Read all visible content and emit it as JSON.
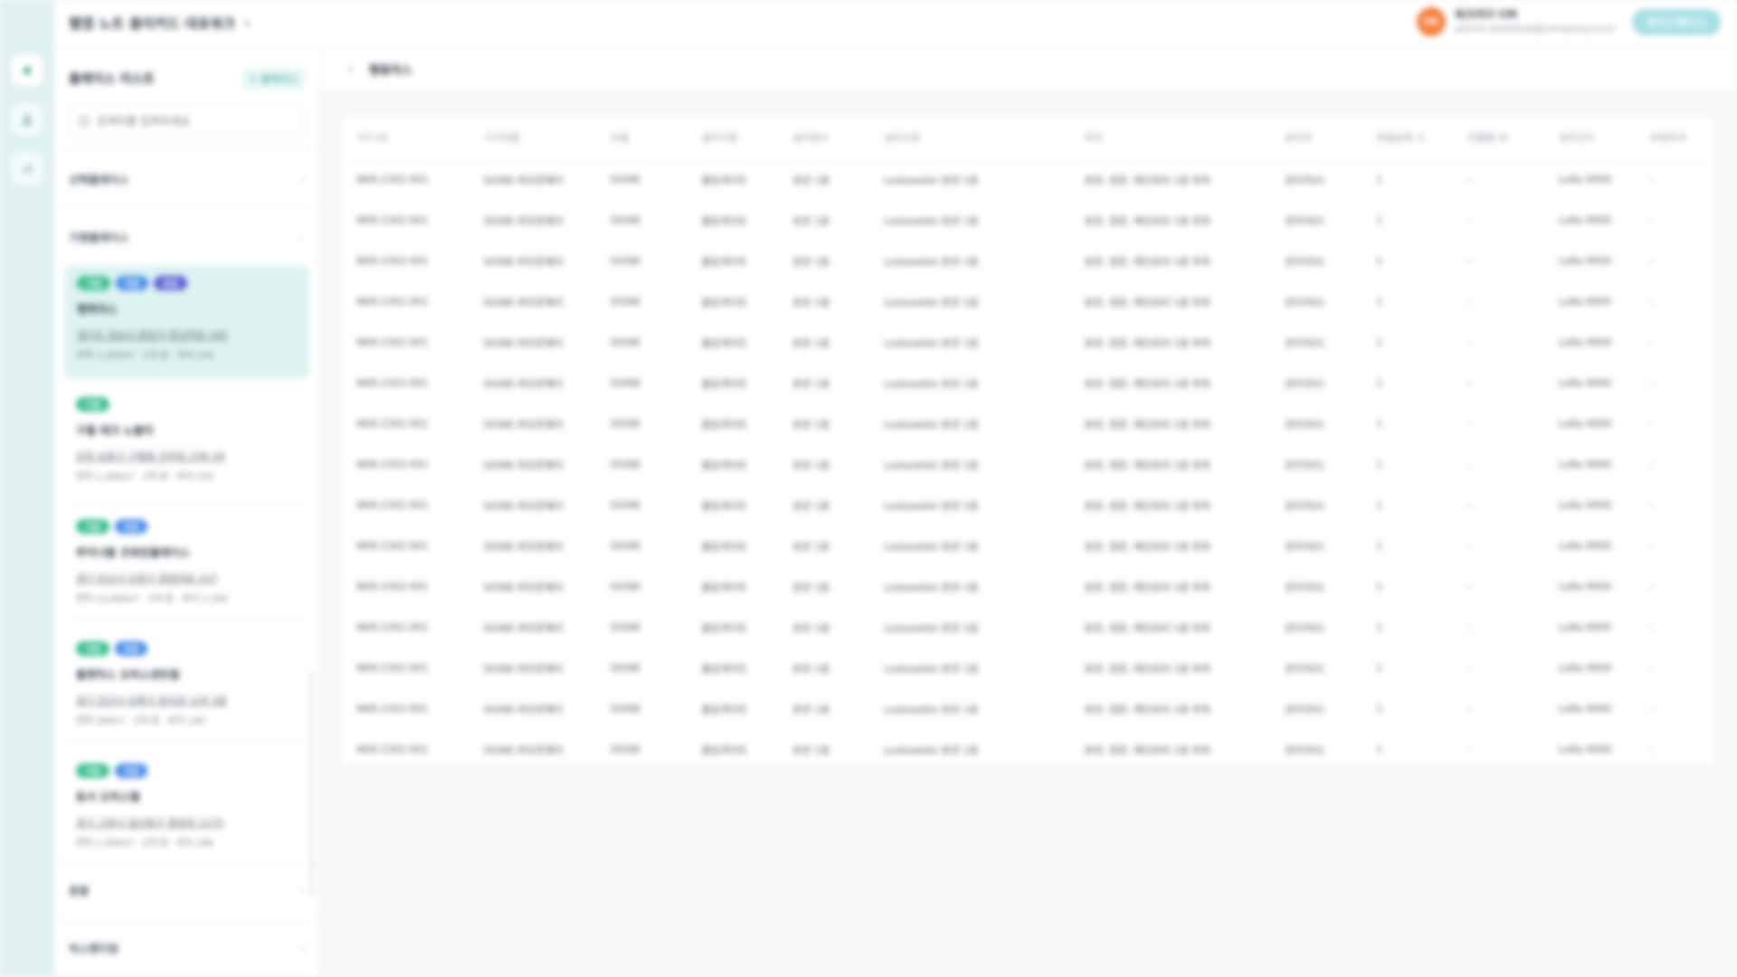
{
  "app": {
    "workspace_name": "웹앱 노트 클리커드 대표워크",
    "user": {
      "initials": "SK",
      "name": "워크리더 CM",
      "email": "admin.workflow@company.co.kr",
      "action_label": "워크스페이스"
    }
  },
  "rail": {
    "icons": [
      "home-icon",
      "people-icon",
      "chart-icon"
    ]
  },
  "sidebar": {
    "title": "플레이스 리스트",
    "add_label": "+ 플레이스",
    "search_placeholder": "검색어를 입력하세요",
    "sections_top": [
      {
        "label": "선택플레이스"
      },
      {
        "label": "가맹플레이스"
      }
    ],
    "cards": [
      {
        "tags": [
          {
            "text": "가맹",
            "color": "green"
          },
          {
            "text": "직영",
            "color": "blue"
          },
          {
            "text": "본점",
            "color": "indigo"
          }
        ],
        "name": "행복마스",
        "address": "경기도 성남시 분당구 판교역로 192",
        "meta": "면적 1,200m² · 2개 층 · 좌석 234",
        "active": true
      },
      {
        "tags": [
          {
            "text": "가맹",
            "color": "green"
          }
        ],
        "name": "구월 테크 노블타",
        "address": "인천 남동구 구월동 인하로 236-18",
        "meta": "면적 1,300m² · 3개 층 · 좌석 234",
        "active": false
      },
      {
        "tags": [
          {
            "text": "가맹",
            "color": "green"
          },
          {
            "text": "직영",
            "color": "blue"
          }
        ],
        "name": "루미너블 코워킹플레이스",
        "address": "경기 안산시 단원구 중앙대로 227",
        "meta": "면적 14,000m² · 2개 층 · 좌석 1,340",
        "active": false
      },
      {
        "tags": [
          {
            "text": "가맹",
            "color": "green"
          },
          {
            "text": "직영",
            "color": "blue"
          }
        ],
        "name": "플랫마스 오피스센트럴",
        "address": "경기 안산시 상록구 본오로 129 3층",
        "meta": "면적 300m² · 2개 층 · 좌석 140",
        "active": false
      },
      {
        "tags": [
          {
            "text": "가맹",
            "color": "green"
          },
          {
            "text": "직영",
            "color": "blue"
          }
        ],
        "name": "동서 오피스텔",
        "address": "경기 고양시 일산동구 중앙로 1275",
        "meta": "면적 1,300m² · 2개 층 · 좌석 188",
        "active": false
      }
    ],
    "sections_bottom": [
      {
        "label": "층별"
      },
      {
        "label": "하스펜더링"
      }
    ]
  },
  "main": {
    "back_icon": "chevron-left-icon",
    "title": "행동마스",
    "table": {
      "headers": [
        "기기 ID",
        "기기이름",
        "모델",
        "설치구분",
        "설치층수",
        "설치사유",
        "위치",
        "관리자",
        "연결상태 수",
        "모델명 ID",
        "관리코드",
        "부분위치"
      ],
      "rows": [
        [
          "NKR-2302-001",
          "SIGNE-퍼모몬웨이",
          "SIGNE",
          "출입게이트",
          "본관 1층",
          "Lodsewikki 본관 1층",
          "본관, 정문, 메인로비 1층 좌측",
          "관리자01",
          "1",
          "-",
          "LoRa 9000",
          "-"
        ],
        [
          "NKR-2302-001",
          "SIGNE-퍼모몬웨이",
          "SIGNE",
          "출입게이트",
          "본관 1층",
          "Lodsewikki 본관 1층",
          "본관, 정문, 메인로비 1층 좌측",
          "관리자01",
          "1",
          "-",
          "LoRa 9000",
          "-"
        ],
        [
          "NKR-2302-001",
          "SIGNE-퍼모몬웨이",
          "SIGNE",
          "출입게이트",
          "본관 1층",
          "Lodsewikki 본관 1층",
          "본관, 정문, 메인로비 1층 좌측",
          "관리자01",
          "1",
          "-",
          "LoRa 9000",
          "-"
        ],
        [
          "NKR-2302-001",
          "SIGNE-퍼모몬웨이",
          "SIGNE",
          "출입게이트",
          "본관 1층",
          "Lodsewikki 본관 1층",
          "본관, 정문, 메인로비 1층 좌측",
          "관리자01",
          "1",
          "-",
          "LoRa 9000",
          "-"
        ],
        [
          "NKR-2302-001",
          "SIGNE-퍼모몬웨이",
          "SIGNE",
          "출입게이트",
          "본관 1층",
          "Lodsewikki 본관 1층",
          "본관, 정문, 메인로비 1층 좌측",
          "관리자01",
          "1",
          "-",
          "LoRa 9000",
          "-"
        ],
        [
          "NKR-2302-001",
          "SIGNE-퍼모몬웨이",
          "SIGNE",
          "출입게이트",
          "본관 1층",
          "Lodsewikki 본관 1층",
          "본관, 정문, 메인로비 1층 좌측",
          "관리자01",
          "1",
          "-",
          "LoRa 9000",
          "-"
        ],
        [
          "NKR-2302-001",
          "SIGNE-퍼모몬웨이",
          "SIGNE",
          "출입게이트",
          "본관 1층",
          "Lodsewikki 본관 1층",
          "본관, 정문, 메인로비 1층 좌측",
          "관리자01",
          "1",
          "-",
          "LoRa 9000",
          "-"
        ],
        [
          "NKR-2302-001",
          "SIGNE-퍼모몬웨이",
          "SIGNE",
          "출입게이트",
          "본관 1층",
          "Lodsewikki 본관 1층",
          "본관, 정문, 메인로비 1층 좌측",
          "관리자01",
          "1",
          "-",
          "LoRa 9000",
          "-"
        ],
        [
          "NKR-2302-001",
          "SIGNE-퍼모몬웨이",
          "SIGNE",
          "출입게이트",
          "본관 1층",
          "Lodsewikki 본관 1층",
          "본관, 정문, 메인로비 1층 좌측",
          "관리자01",
          "1",
          "-",
          "LoRa 9000",
          "-"
        ],
        [
          "NKR-2302-001",
          "SIGNE-퍼모몬웨이",
          "SIGNE",
          "출입게이트",
          "본관 1층",
          "Lodsewikki 본관 1층",
          "본관, 정문, 메인로비 1층 좌측",
          "관리자01",
          "1",
          "-",
          "LoRa 9000",
          "-"
        ],
        [
          "NKR-2302-001",
          "SIGNE-퍼모몬웨이",
          "SIGNE",
          "출입게이트",
          "본관 1층",
          "Lodsewikki 본관 1층",
          "본관, 정문, 메인로비 1층 좌측",
          "관리자01",
          "1",
          "-",
          "LoRa 9000",
          "-"
        ],
        [
          "NKR-2302-001",
          "SIGNE-퍼모몬웨이",
          "SIGNE",
          "출입게이트",
          "본관 1층",
          "Lodsewikki 본관 1층",
          "본관, 정문, 메인로비 1층 좌측",
          "관리자01",
          "1",
          "-",
          "LoRa 9000",
          "-"
        ],
        [
          "NKR-2302-001",
          "SIGNE-퍼모몬웨이",
          "SIGNE",
          "출입게이트",
          "본관 1층",
          "Lodsewikki 본관 1층",
          "본관, 정문, 메인로비 1층 좌측",
          "관리자01",
          "1",
          "-",
          "LoRa 9000",
          "-"
        ],
        [
          "NKR-2302-001",
          "SIGNE-퍼모몬웨이",
          "SIGNE",
          "출입게이트",
          "본관 1층",
          "Lodsewikki 본관 1층",
          "본관, 정문, 메인로비 1층 좌측",
          "관리자01",
          "1",
          "-",
          "LoRa 9000",
          "-"
        ],
        [
          "NKR-2302-001",
          "SIGNE-퍼모몬웨이",
          "SIGNE",
          "출입게이트",
          "본관 1층",
          "Lodsewikki 본관 1층",
          "본관, 정문, 메인로비 1층 좌측",
          "관리자01",
          "1",
          "-",
          "LoRa 9000",
          "-"
        ]
      ]
    }
  },
  "colors": {
    "accent": "#2fa7a3",
    "rail_bg": "#dff1f0",
    "active_card": "#dcf3f1",
    "avatar": "#f57c3a",
    "tag_green": "#3cc08f",
    "tag_blue": "#4a8fe8",
    "tag_indigo": "#5b5fd6"
  }
}
